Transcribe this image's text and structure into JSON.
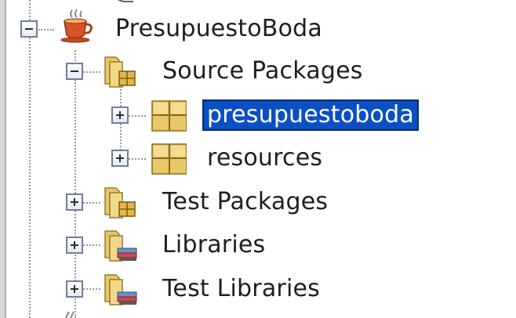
{
  "tree": {
    "project": {
      "label": "PresupuestoBoda",
      "icon": "coffee-cup-project-icon",
      "expanded": true
    },
    "nodes": [
      {
        "id": "source-packages",
        "label": "Source Packages",
        "icon": "source-folder-icon",
        "expanded": true,
        "selected": false
      },
      {
        "id": "presupuestoboda",
        "label": "presupuestoboda",
        "icon": "package-icon",
        "expanded": false,
        "selected": true
      },
      {
        "id": "resources",
        "label": "resources",
        "icon": "package-icon",
        "expanded": false,
        "selected": false
      },
      {
        "id": "test-packages",
        "label": "Test Packages",
        "icon": "test-folder-icon",
        "expanded": false,
        "selected": false
      },
      {
        "id": "libraries",
        "label": "Libraries",
        "icon": "library-folder-icon",
        "expanded": false,
        "selected": false
      },
      {
        "id": "test-libraries",
        "label": "Test Libraries",
        "icon": "library-folder-icon",
        "expanded": false,
        "selected": false
      }
    ],
    "colors": {
      "selection_bg": "#0a4fc4",
      "selection_text": "#ffffff",
      "text": "#1e1e1e",
      "folder": "#e8c766",
      "package": "#e3c46a"
    }
  }
}
